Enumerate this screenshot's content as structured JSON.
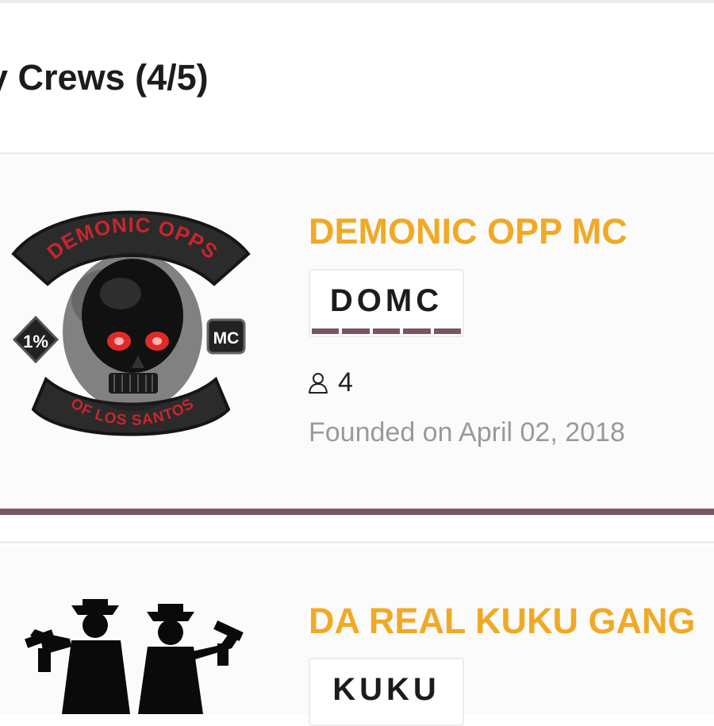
{
  "section": {
    "title": "y Crews (4/5)"
  },
  "crews": [
    {
      "name": "DEMONIC OPP MC",
      "tag": "DOMC",
      "members": "4",
      "founded": "Founded on April 02, 2018",
      "emblem": {
        "top_rocker": "DEMONIC OPPS",
        "bottom_rocker": "OF LOS SANTOS",
        "left_diamond": "1%",
        "side_patch": "MC"
      }
    },
    {
      "name": "DA REAL KUKU GANG",
      "tag": "KUKU"
    }
  ],
  "colors": {
    "accent": "#7a5563",
    "crew_name": "#f1a925",
    "muted_text": "#9a9a9a"
  },
  "icons": {
    "members": "person-outline-icon"
  }
}
